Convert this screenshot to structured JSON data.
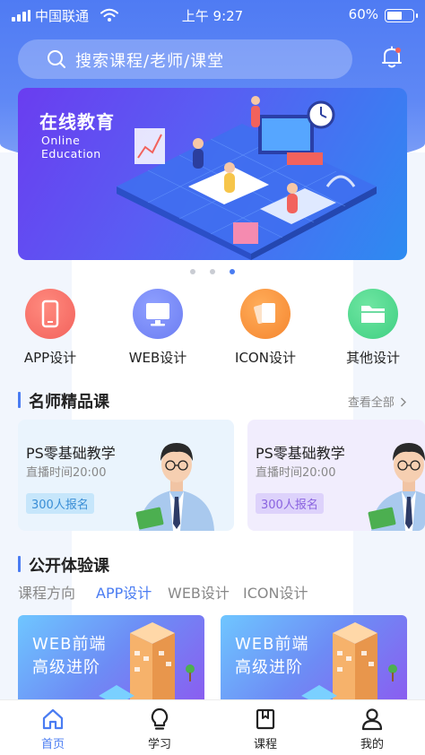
{
  "status_bar": {
    "carrier": "中国联通",
    "time": "上午 9:27",
    "battery": "60%",
    "battery_level": 0.6
  },
  "search": {
    "placeholder": "搜索课程/老师/课堂"
  },
  "banner": {
    "title_cn": "在线教育",
    "title_en_1": "Online",
    "title_en_2": "Education",
    "active_dot": 3,
    "dot_count": 3
  },
  "categories": [
    {
      "label": "APP设计",
      "icon": "phone-icon",
      "color": "#f2625c"
    },
    {
      "label": "WEB设计",
      "icon": "monitor-icon",
      "color": "#6c7df2"
    },
    {
      "label": "ICON设计",
      "icon": "cards-icon",
      "color": "#f5862f"
    },
    {
      "label": "其他设计",
      "icon": "folder-icon",
      "color": "#3fcf82"
    }
  ],
  "famous": {
    "title": "名师精品课",
    "see_all": "查看全部",
    "cards": [
      {
        "title": "PS零基础教学",
        "time": "直播时间20:00",
        "badge": "300人报名",
        "bg": "#eaf4fd",
        "badge_bg": "#c6e6fb",
        "badge_color": "#3a8ed6"
      },
      {
        "title": "PS零基础教学",
        "time": "直播时间20:00",
        "badge": "300人报名",
        "bg": "#f1edfd",
        "badge_bg": "#ddd2fb",
        "badge_color": "#8a63e0"
      }
    ]
  },
  "open": {
    "title": "公开体验课",
    "tabs": [
      "课程方向",
      "APP设计",
      "WEB设计",
      "ICON设计"
    ],
    "active_tab": 1,
    "courses": [
      {
        "line1": "WEB前端",
        "line2": "高级进阶"
      },
      {
        "line1": "WEB前端",
        "line2": "高级进阶"
      }
    ]
  },
  "tabbar": [
    {
      "label": "首页",
      "icon": "home-icon",
      "active": true
    },
    {
      "label": "学习",
      "icon": "bulb-icon",
      "active": false
    },
    {
      "label": "课程",
      "icon": "book-icon",
      "active": false
    },
    {
      "label": "我的",
      "icon": "user-icon",
      "active": false
    }
  ],
  "colors": {
    "primary": "#4a7cf2",
    "header": "#5b85f4"
  }
}
